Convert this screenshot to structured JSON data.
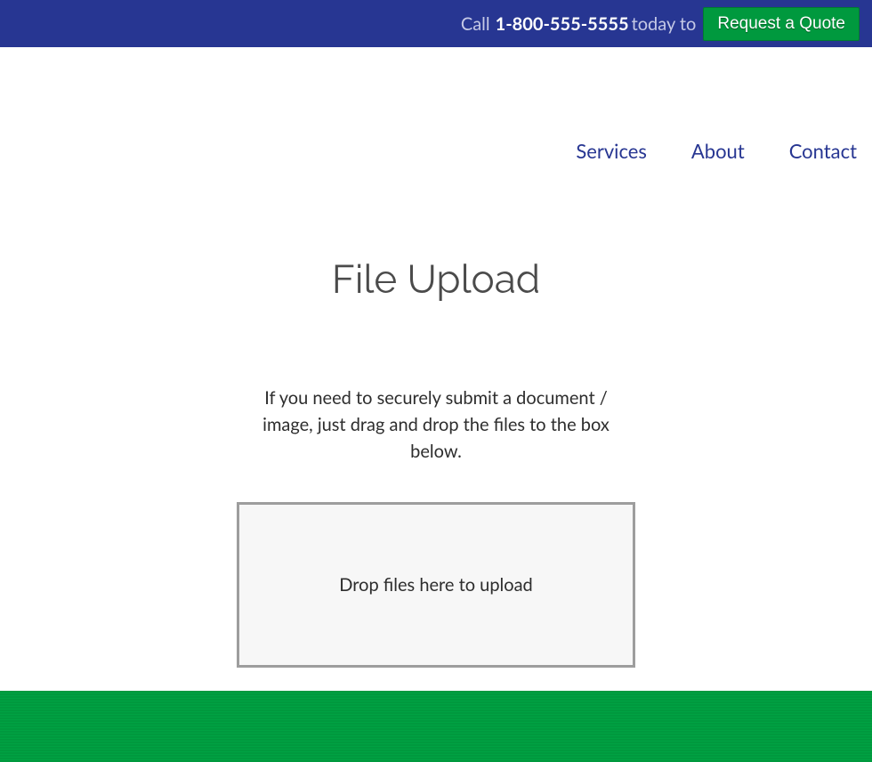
{
  "topbar": {
    "call_prefix": "Call ",
    "phone": "1-800-555-5555",
    "today_to": " today to",
    "quote_button": "Request a Quote"
  },
  "nav": {
    "services": "Services",
    "about": "About",
    "contact": "Contact"
  },
  "page": {
    "title": "File Upload",
    "description": "If you need to securely submit a document / image, just drag and drop the files to the box below.",
    "dropzone_text": "Drop files here to upload"
  },
  "colors": {
    "primary_blue": "#273692",
    "primary_green": "#00993e"
  }
}
